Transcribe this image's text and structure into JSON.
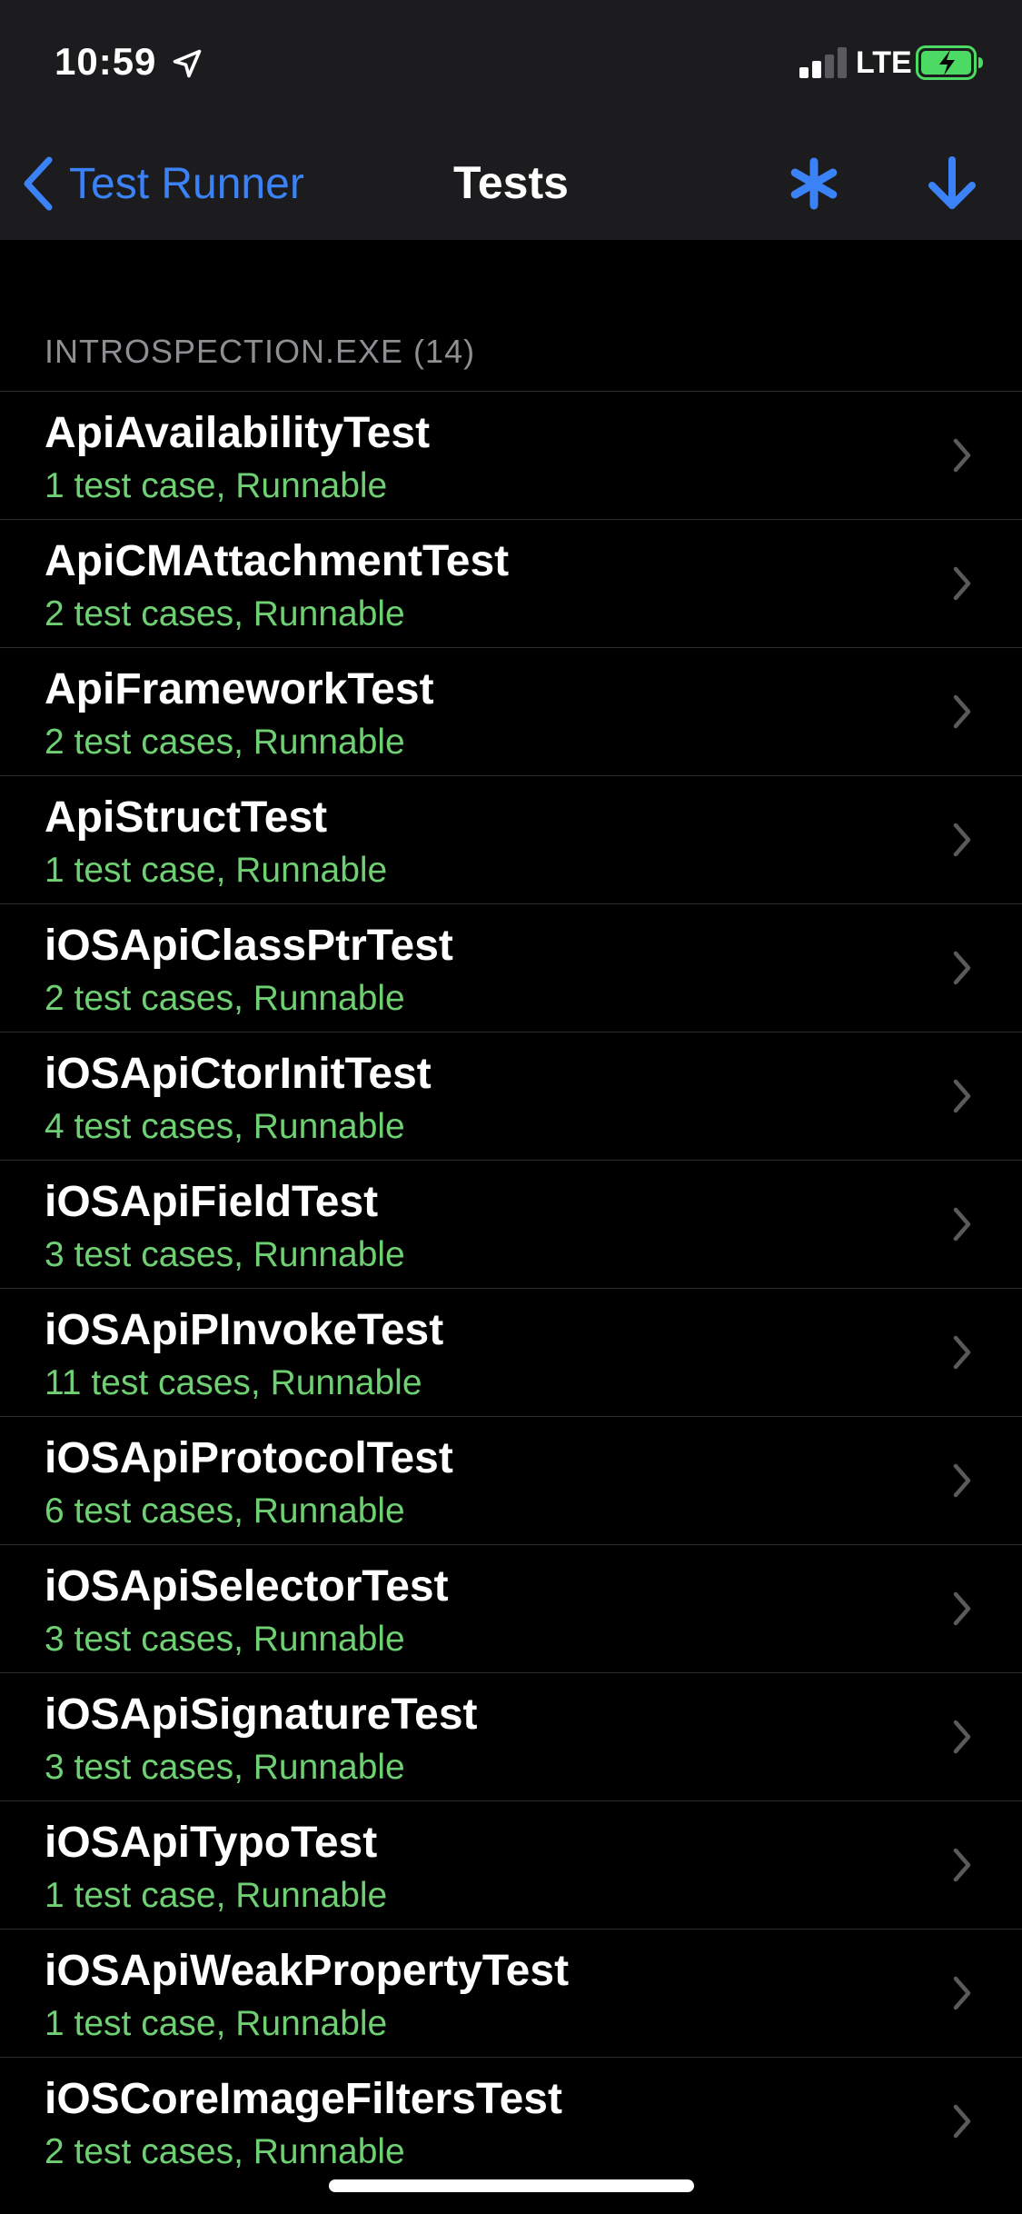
{
  "status_bar": {
    "time": "10:59",
    "network": "LTE",
    "icons": {
      "location": "location-arrow-icon",
      "signal": "signal-bars-icon",
      "battery": "battery-charging-icon"
    },
    "colors": {
      "battery_fill": "#4cd964"
    }
  },
  "nav": {
    "back_label": "Test Runner",
    "title": "Tests",
    "icons": {
      "back": "chevron-left-icon",
      "asterisk": "asterisk-icon",
      "download": "arrow-down-icon"
    },
    "colors": {
      "accent": "#3b82f6"
    }
  },
  "section": {
    "header": "INTROSPECTION.EXE (14)"
  },
  "tests": [
    {
      "name": "ApiAvailabilityTest",
      "summary": "1 test case, Runnable"
    },
    {
      "name": "ApiCMAttachmentTest",
      "summary": "2 test cases, Runnable"
    },
    {
      "name": "ApiFrameworkTest",
      "summary": "2 test cases, Runnable"
    },
    {
      "name": "ApiStructTest",
      "summary": "1 test case, Runnable"
    },
    {
      "name": "iOSApiClassPtrTest",
      "summary": "2 test cases, Runnable"
    },
    {
      "name": "iOSApiCtorInitTest",
      "summary": "4 test cases, Runnable"
    },
    {
      "name": "iOSApiFieldTest",
      "summary": "3 test cases, Runnable"
    },
    {
      "name": "iOSApiPInvokeTest",
      "summary": "11 test cases, Runnable"
    },
    {
      "name": "iOSApiProtocolTest",
      "summary": "6 test cases, Runnable"
    },
    {
      "name": "iOSApiSelectorTest",
      "summary": "3 test cases, Runnable"
    },
    {
      "name": "iOSApiSignatureTest",
      "summary": "3 test cases, Runnable"
    },
    {
      "name": "iOSApiTypoTest",
      "summary": "1 test case, Runnable"
    },
    {
      "name": "iOSApiWeakPropertyTest",
      "summary": "1 test case, Runnable"
    },
    {
      "name": "iOSCoreImageFiltersTest",
      "summary": "2 test cases, Runnable"
    }
  ],
  "colors": {
    "runnable_text": "#6fcf73",
    "section_header_text": "#8e8e93",
    "nav_background": "#1c1c1e"
  }
}
